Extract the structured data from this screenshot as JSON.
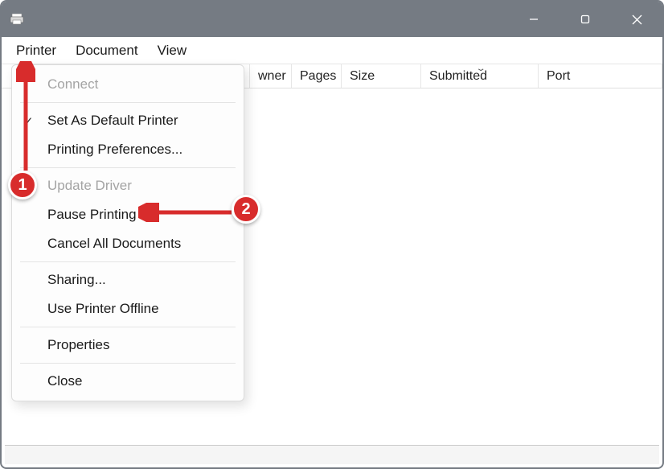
{
  "titlebar": {
    "title": ""
  },
  "menubar": {
    "items": [
      "Printer",
      "Document",
      "View"
    ]
  },
  "columns": {
    "headers": [
      "wner",
      "Pages",
      "Size",
      "Submitted",
      "Port"
    ]
  },
  "dropdown": {
    "items": [
      {
        "label": "Connect",
        "disabled": true,
        "checked": false,
        "sep_after": true
      },
      {
        "label": "Set As Default Printer",
        "disabled": false,
        "checked": true,
        "sep_after": false
      },
      {
        "label": "Printing Preferences...",
        "disabled": false,
        "checked": false,
        "sep_after": true
      },
      {
        "label": "Update Driver",
        "disabled": true,
        "checked": false,
        "sep_after": false
      },
      {
        "label": "Pause Printing",
        "disabled": false,
        "checked": false,
        "sep_after": false
      },
      {
        "label": "Cancel All Documents",
        "disabled": false,
        "checked": false,
        "sep_after": true
      },
      {
        "label": "Sharing...",
        "disabled": false,
        "checked": false,
        "sep_after": false
      },
      {
        "label": "Use Printer Offline",
        "disabled": false,
        "checked": false,
        "sep_after": true
      },
      {
        "label": "Properties",
        "disabled": false,
        "checked": false,
        "sep_after": true
      },
      {
        "label": "Close",
        "disabled": false,
        "checked": false,
        "sep_after": false
      }
    ]
  },
  "annotations": {
    "badge1": "1",
    "badge2": "2"
  },
  "colors": {
    "accent": "#d82c2c",
    "titlebar": "#757b83"
  }
}
